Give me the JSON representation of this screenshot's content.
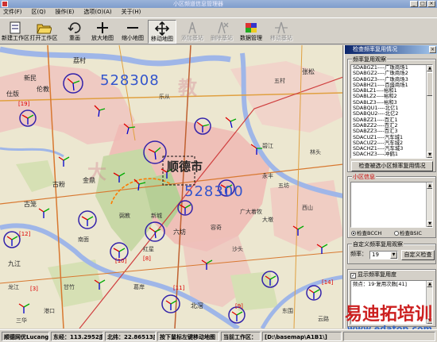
{
  "window": {
    "title": "小区频道信息管理器"
  },
  "menu": {
    "items": [
      "文件(F)",
      "区(Q)",
      "操作(E)",
      "选项(O)(A)",
      "关于(H)"
    ]
  },
  "toolbar": {
    "buttons": [
      {
        "label": "新建工作区",
        "icon": "new-workspace-icon",
        "enabled": true
      },
      {
        "label": "打开工作区",
        "icon": "open-folder-icon",
        "enabled": true
      },
      {
        "label": "重画",
        "icon": "redraw-icon",
        "enabled": true
      },
      {
        "label": "放大地图",
        "icon": "zoom-in-icon",
        "enabled": true
      },
      {
        "label": "缩小地图",
        "icon": "zoom-out-icon",
        "enabled": true
      },
      {
        "label": "移动地图",
        "icon": "pan-icon",
        "enabled": true,
        "pressed": true
      },
      {
        "label": "添加基站",
        "icon": "add-station-icon",
        "enabled": false
      },
      {
        "label": "删除基站",
        "icon": "delete-station-icon",
        "enabled": false
      },
      {
        "label": "数据管理",
        "icon": "data-manage-icon",
        "enabled": true
      },
      {
        "label": "移动基站",
        "icon": "move-station-icon",
        "enabled": false
      }
    ]
  },
  "map": {
    "zip_codes": [
      "528308",
      "528300"
    ],
    "city_name": "顺德市",
    "watermark_chars": [
      "大",
      "教"
    ],
    "places": [
      "荔村",
      "新民",
      "伦教",
      "仕版",
      "古粉",
      "金鼎",
      "古笼",
      "九江",
      "南面",
      "弼教",
      "新城",
      "甘竹",
      "五坊",
      "六坊",
      "容奇",
      "大墩",
      "西山",
      "北滘",
      "沙头",
      "广大着牧",
      "龙江",
      "红星",
      "碧江",
      "乐从",
      "永丰",
      "五村",
      "张松",
      "云路",
      "三华",
      "东围",
      "港口",
      "葛岸",
      "林头"
    ],
    "site_labels": [
      "[19]",
      "[12]",
      "[3]",
      "[8]",
      "[10]",
      "[14]",
      "[11]",
      "[9]"
    ]
  },
  "panel": {
    "title": "检查频率复用情况",
    "reuse_group_label": "频率复用观察",
    "reuse_list": [
      "SDABGZ1----广珠商场1",
      "SDABGZ2----广珠商场2",
      "SDABGZ3----广珠商场3",
      "SDABHZ1----百盛商场1",
      "SDABLZ1----裕和1",
      "SDABLZ2----裕和2",
      "SDABLZ3----裕和3",
      "SDABQU1----北亿1",
      "SDABQU2----北亿2",
      "SDABZZ1----百汇1",
      "SDABZZ2----百汇2",
      "SDABZZ3----百汇3",
      "SDACUZ1----汽车城1",
      "SDACUZ2----汽车城2",
      "SDACHZ1----汽车城3",
      "SDACHZ3----冲鹤1"
    ],
    "check_button": "检查被选小区频率复用情况",
    "cell_info_label": "小区信息",
    "radio_bcch": "检查BCCH",
    "radio_bsic": "检查BSIC",
    "custom_group_label": "自定义频率复用观察",
    "freq_label": "频率：",
    "freq_value": "19",
    "custom_button": "自定义检查",
    "reuse_degree_label": "显示频率复用度",
    "reuse_degree_text": "频点：19·复用次数[41]"
  },
  "status": {
    "app_label": "顺德网优Lucang",
    "east": "东经：113.2952度",
    "north": "北纬：22.86513度",
    "hint": "按下鼠标左键移动地图",
    "workspace_label": "当前工作区：",
    "workspace_path": "[D:\\basemap\\A1B1\\]"
  },
  "watermark": {
    "brand": "易迪拓培训",
    "url": "www.edatop.com"
  },
  "colors": {
    "accent_blue": "#0a246a",
    "map_bg": "#ece7d0",
    "urban": "#f0b8b4",
    "green_zone": "#c8d8a6",
    "water": "#9fb6e8"
  }
}
